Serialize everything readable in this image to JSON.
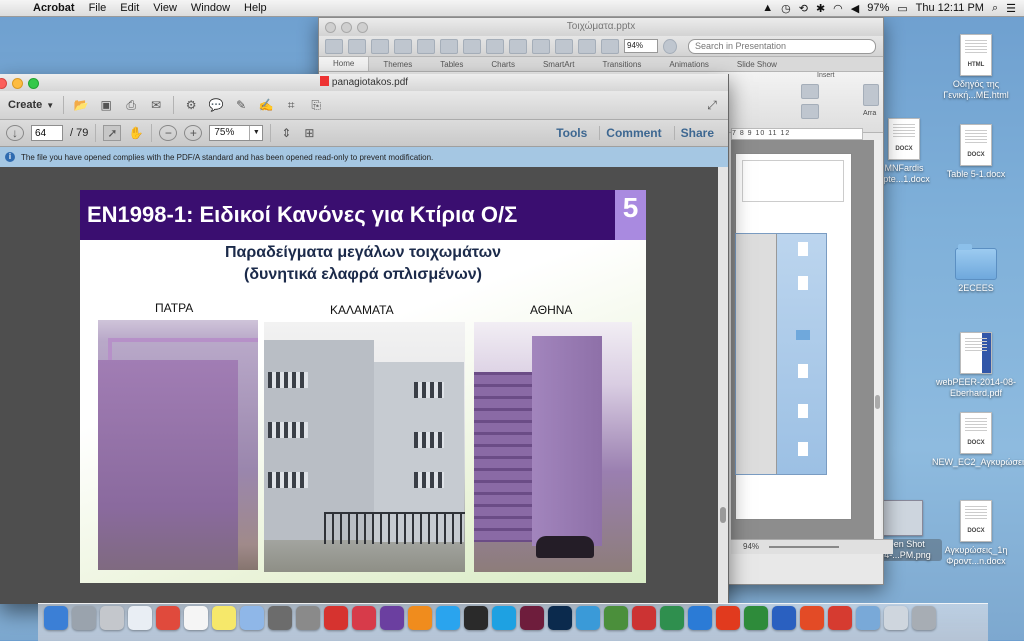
{
  "menubar": {
    "app": "Acrobat",
    "items": [
      "File",
      "Edit",
      "View",
      "Window",
      "Help"
    ],
    "battery": "97%",
    "clock": "Thu 12:11 PM"
  },
  "desktop": {
    "icons": [
      {
        "badge": "HTML",
        "label": "Οδηγός της Γενική...ME.html"
      },
      {
        "badge": "DOCX",
        "label": "MNFardis apte...1.docx"
      },
      {
        "badge": "DOCX",
        "label": "Table 5-1.docx"
      },
      {
        "badge": "",
        "label": "2ECEES"
      },
      {
        "badge": "",
        "label": "webPEER-2014-08-Eberhard.pdf"
      },
      {
        "badge": "DOCX",
        "label": "NEW_EC2_Αγκυρώσεις...n.docx"
      },
      {
        "badge": "DOCX",
        "label": "Αγκυρώσεις_1η Φροντ...n.docx"
      },
      {
        "badge": "",
        "label": "Screen Shot 2014-...PM.png"
      }
    ]
  },
  "ppt": {
    "title": "Τοιχώματα.pptx",
    "zoom": "94%",
    "search_placeholder": "Search in Presentation",
    "tabs": [
      "Home",
      "Themes",
      "Tables",
      "Charts",
      "SmartArt",
      "Transitions",
      "Animations",
      "Slide Show"
    ],
    "insert_label": "Insert",
    "arrange_label": "Arra",
    "ruler": "7 8 9 10 11 12",
    "status_zoom": "94%"
  },
  "acrobat": {
    "title": "panagiotakos.pdf",
    "create_label": "Create",
    "page_current": "64",
    "page_total": "/ 79",
    "zoom": "75%",
    "tools": "Tools",
    "comment": "Comment",
    "share": "Share",
    "info": "The file you have opened complies with the PDF/A standard and has been opened read-only to prevent modification."
  },
  "slide": {
    "title": "EN1998-1: Ειδικοί Κανόνες για Κτίρια Ο/Σ",
    "number": "5",
    "subtitle_line1": "Παραδείγματα μεγάλων τοιχωμάτων",
    "subtitle_line2": "(δυνητικά ελαφρά οπλισμένων)",
    "cities": [
      "ΠΑΤΡΑ",
      "ΚΑΛΑΜΑΤΑ",
      "ΑΘΗΝΑ"
    ]
  },
  "dock": {
    "colors": [
      "#3b7fd6",
      "#9aa3ad",
      "#c4c7cc",
      "#e9eef4",
      "#e04a3c",
      "#f5f5f5",
      "#f6e86a",
      "#8fb7e8",
      "#6c6c6c",
      "#8a8a8a",
      "#d6332f",
      "#d73b4a",
      "#6b3fa0",
      "#f08c1d",
      "#2aa4ee",
      "#2a2a2a",
      "#1ea1e2",
      "#6e1d3c",
      "#0b2a4d",
      "#3a9ad8",
      "#4b8f3b",
      "#c33",
      "#2f8f4e",
      "#2b7bd6",
      "#e13a1e",
      "#2e8b3a",
      "#2a60c0",
      "#e34b26",
      "#d63b30",
      "#79a9d8",
      "#cfd6de",
      "#a7adb4"
    ]
  }
}
